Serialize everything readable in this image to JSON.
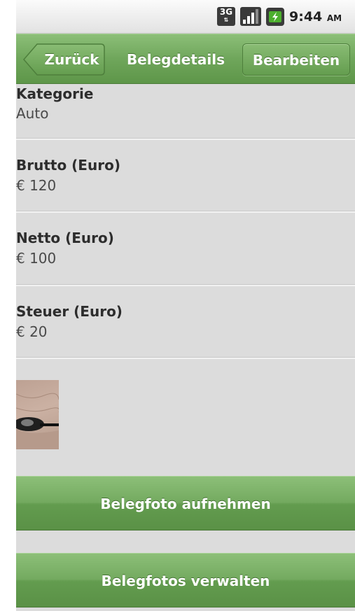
{
  "status_bar": {
    "network_type": "3G",
    "time": "9:44",
    "ampm": "AM",
    "icons": [
      "3g-data-icon",
      "signal-strength-icon",
      "battery-charging-icon"
    ]
  },
  "title_bar": {
    "back_label": "Zurück",
    "title": "Belegdetails",
    "edit_label": "Bearbeiten"
  },
  "details": [
    {
      "label": "Kategorie",
      "value": "Auto"
    },
    {
      "label": "Brutto (Euro)",
      "value": "€ 120"
    },
    {
      "label": "Netto (Euro)",
      "value": "€ 100"
    },
    {
      "label": "Steuer (Euro)",
      "value": "€ 20"
    }
  ],
  "actions": {
    "take_photo_label": "Belegfoto aufnehmen",
    "manage_photos_label": "Belegfotos verwalten"
  },
  "colors": {
    "accent_green": "#6fa65b",
    "background": "#dcdcdc",
    "battery_green": "#4caf2e"
  }
}
